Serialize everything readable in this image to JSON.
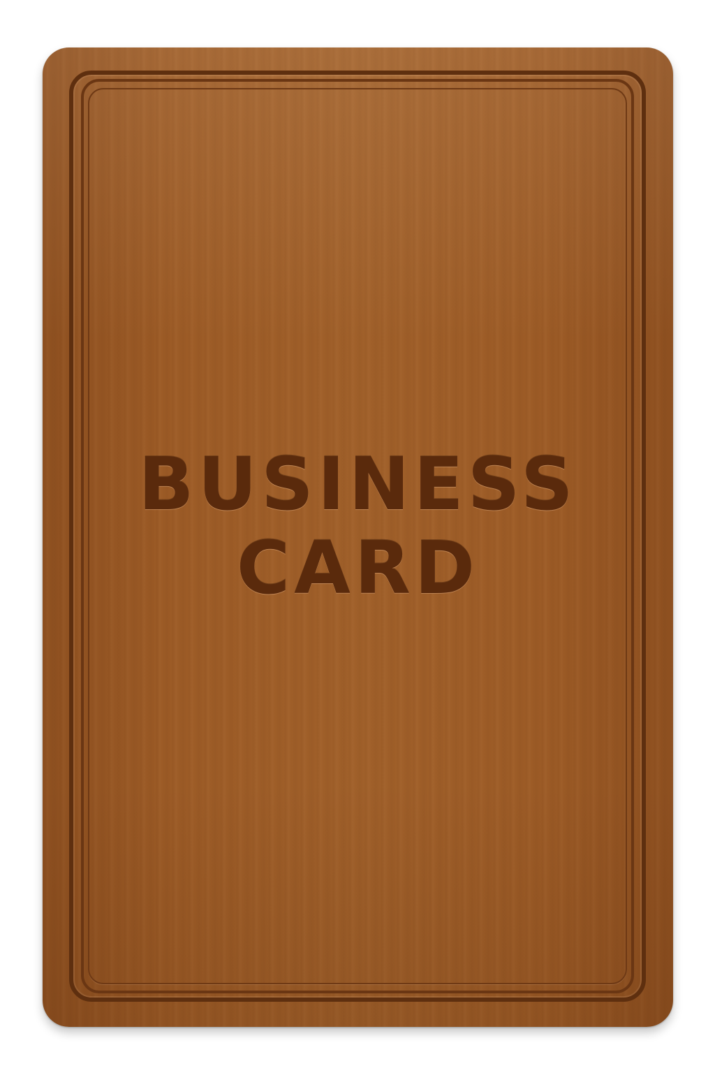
{
  "card": {
    "title_line_1": "BUSINESS",
    "title_line_2": "CARD"
  },
  "colors": {
    "wood": "#9c5b26",
    "border": "#5e2f0f",
    "text": "#5a2a0c",
    "background": "#ffffff"
  }
}
